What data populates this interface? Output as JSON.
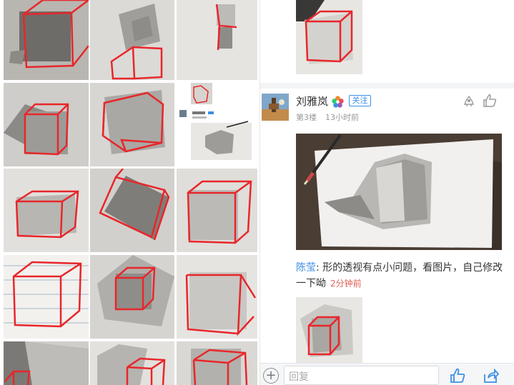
{
  "thread": {
    "post": {
      "username": "刘雅岚",
      "follow_label": "关注",
      "floor": "第3楼",
      "time": "13小时前"
    },
    "reply": {
      "author": "陈莹",
      "separator": ": ",
      "text": "形的透视有点小问题，看图片，自己修改一下呦",
      "time": "2分钟前"
    },
    "bottom_bar": {
      "reply_placeholder": "回复"
    }
  },
  "icons": {
    "add": "plus-circle-icon",
    "like": "thumbs-up-icon",
    "share": "share-icon",
    "report": "report-icon",
    "badge": "flower-badge-icon"
  },
  "colors": {
    "accent_blue": "#3d8fe4",
    "time_red": "#e06055",
    "sketch_red": "#e8262b"
  },
  "grid": {
    "mini_post": {
      "username": "刘雅岚",
      "follow_label": "关注"
    }
  }
}
